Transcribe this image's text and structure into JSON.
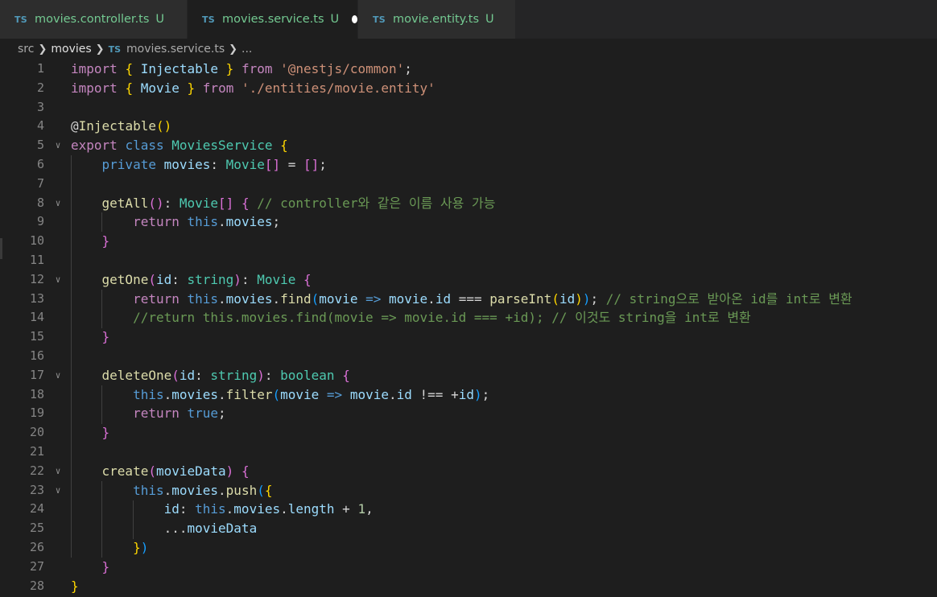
{
  "tabs": [
    {
      "icon": "TS",
      "name": "movies.controller.ts",
      "status": "U",
      "active": false,
      "dirty": false
    },
    {
      "icon": "TS",
      "name": "movies.service.ts",
      "status": "U",
      "active": true,
      "dirty": true
    },
    {
      "icon": "TS",
      "name": "movie.entity.ts",
      "status": "U",
      "active": false,
      "dirty": false
    }
  ],
  "breadcrumb": {
    "items": [
      "src",
      "movies"
    ],
    "file_icon": "TS",
    "file": "movies.service.ts",
    "more": "..."
  },
  "colors": {
    "keyword": "#c586c0",
    "storage": "#569cd6",
    "class": "#4ec9b0",
    "function": "#dcdcaa",
    "variable": "#9cdcfe",
    "string": "#ce9178",
    "comment": "#6a9955",
    "number": "#b5cea8",
    "bracket1": "#ffd700",
    "bracket2": "#da70d6",
    "bracket3": "#179fff",
    "text": "#d4d4d4"
  },
  "code": {
    "lines": [
      {
        "n": "1",
        "fold": false,
        "tokens": [
          [
            "import",
            "keyword"
          ],
          [
            " ",
            "text"
          ],
          [
            "{",
            "bracket1"
          ],
          [
            " Injectable ",
            "variable"
          ],
          [
            "}",
            "bracket1"
          ],
          [
            " ",
            "text"
          ],
          [
            "from",
            "keyword"
          ],
          [
            " ",
            "text"
          ],
          [
            "'@nestjs/common'",
            "string"
          ],
          [
            ";",
            "text"
          ]
        ]
      },
      {
        "n": "2",
        "fold": false,
        "tokens": [
          [
            "import",
            "keyword"
          ],
          [
            " ",
            "text"
          ],
          [
            "{",
            "bracket1"
          ],
          [
            " Movie ",
            "variable"
          ],
          [
            "}",
            "bracket1"
          ],
          [
            " ",
            "text"
          ],
          [
            "from",
            "keyword"
          ],
          [
            " ",
            "text"
          ],
          [
            "'./entities/movie.entity'",
            "string"
          ]
        ]
      },
      {
        "n": "3",
        "fold": false,
        "tokens": []
      },
      {
        "n": "4",
        "fold": false,
        "tokens": [
          [
            "@",
            "text"
          ],
          [
            "Injectable",
            "function"
          ],
          [
            "()",
            "bracket1"
          ]
        ]
      },
      {
        "n": "5",
        "fold": true,
        "tokens": [
          [
            "export",
            "keyword"
          ],
          [
            " ",
            "text"
          ],
          [
            "class",
            "storage"
          ],
          [
            " ",
            "text"
          ],
          [
            "MoviesService",
            "class"
          ],
          [
            " ",
            "text"
          ],
          [
            "{",
            "bracket1"
          ]
        ]
      },
      {
        "n": "6",
        "fold": false,
        "tokens": [
          [
            "    ",
            "text"
          ],
          [
            "private",
            "storage"
          ],
          [
            " ",
            "text"
          ],
          [
            "movies",
            "variable"
          ],
          [
            ": ",
            "text"
          ],
          [
            "Movie",
            "class"
          ],
          [
            "[]",
            "bracket2"
          ],
          [
            " = ",
            "text"
          ],
          [
            "[]",
            "bracket2"
          ],
          [
            ";",
            "text"
          ]
        ]
      },
      {
        "n": "7",
        "fold": false,
        "tokens": []
      },
      {
        "n": "8",
        "fold": true,
        "tokens": [
          [
            "    ",
            "text"
          ],
          [
            "getAll",
            "function"
          ],
          [
            "()",
            "bracket2"
          ],
          [
            ": ",
            "text"
          ],
          [
            "Movie",
            "class"
          ],
          [
            "[]",
            "bracket2"
          ],
          [
            " ",
            "text"
          ],
          [
            "{",
            "bracket2"
          ],
          [
            " ",
            "text"
          ],
          [
            "// controller와 같은 이름 사용 가능",
            "comment"
          ]
        ]
      },
      {
        "n": "9",
        "fold": false,
        "tokens": [
          [
            "        ",
            "text"
          ],
          [
            "return",
            "keyword"
          ],
          [
            " ",
            "text"
          ],
          [
            "this",
            "storage"
          ],
          [
            ".",
            "text"
          ],
          [
            "movies",
            "variable"
          ],
          [
            ";",
            "text"
          ]
        ]
      },
      {
        "n": "10",
        "fold": false,
        "tokens": [
          [
            "    ",
            "text"
          ],
          [
            "}",
            "bracket2"
          ]
        ]
      },
      {
        "n": "11",
        "fold": false,
        "tokens": []
      },
      {
        "n": "12",
        "fold": true,
        "tokens": [
          [
            "    ",
            "text"
          ],
          [
            "getOne",
            "function"
          ],
          [
            "(",
            "bracket2"
          ],
          [
            "id",
            "variable"
          ],
          [
            ": ",
            "text"
          ],
          [
            "string",
            "class"
          ],
          [
            ")",
            "bracket2"
          ],
          [
            ": ",
            "text"
          ],
          [
            "Movie",
            "class"
          ],
          [
            " ",
            "text"
          ],
          [
            "{",
            "bracket2"
          ]
        ]
      },
      {
        "n": "13",
        "fold": false,
        "tokens": [
          [
            "        ",
            "text"
          ],
          [
            "return",
            "keyword"
          ],
          [
            " ",
            "text"
          ],
          [
            "this",
            "storage"
          ],
          [
            ".",
            "text"
          ],
          [
            "movies",
            "variable"
          ],
          [
            ".",
            "text"
          ],
          [
            "find",
            "function"
          ],
          [
            "(",
            "bracket3"
          ],
          [
            "movie",
            "variable"
          ],
          [
            " ",
            "text"
          ],
          [
            "=>",
            "storage"
          ],
          [
            " ",
            "text"
          ],
          [
            "movie",
            "variable"
          ],
          [
            ".",
            "text"
          ],
          [
            "id",
            "variable"
          ],
          [
            " === ",
            "text"
          ],
          [
            "parseInt",
            "function"
          ],
          [
            "(",
            "bracket1"
          ],
          [
            "id",
            "variable"
          ],
          [
            ")",
            "bracket1"
          ],
          [
            ")",
            "bracket3"
          ],
          [
            ";",
            "text"
          ],
          [
            " ",
            "text"
          ],
          [
            "// string으로 받아온 id를 int로 변환",
            "comment"
          ]
        ]
      },
      {
        "n": "14",
        "fold": false,
        "tokens": [
          [
            "        ",
            "text"
          ],
          [
            "//return this.movies.find(movie => movie.id === +id); // 이것도 string을 int로 변환",
            "comment"
          ]
        ]
      },
      {
        "n": "15",
        "fold": false,
        "tokens": [
          [
            "    ",
            "text"
          ],
          [
            "}",
            "bracket2"
          ]
        ]
      },
      {
        "n": "16",
        "fold": false,
        "tokens": []
      },
      {
        "n": "17",
        "fold": true,
        "tokens": [
          [
            "    ",
            "text"
          ],
          [
            "deleteOne",
            "function"
          ],
          [
            "(",
            "bracket2"
          ],
          [
            "id",
            "variable"
          ],
          [
            ": ",
            "text"
          ],
          [
            "string",
            "class"
          ],
          [
            ")",
            "bracket2"
          ],
          [
            ": ",
            "text"
          ],
          [
            "boolean",
            "class"
          ],
          [
            " ",
            "text"
          ],
          [
            "{",
            "bracket2"
          ]
        ]
      },
      {
        "n": "18",
        "fold": false,
        "tokens": [
          [
            "        ",
            "text"
          ],
          [
            "this",
            "storage"
          ],
          [
            ".",
            "text"
          ],
          [
            "movies",
            "variable"
          ],
          [
            ".",
            "text"
          ],
          [
            "filter",
            "function"
          ],
          [
            "(",
            "bracket3"
          ],
          [
            "movie",
            "variable"
          ],
          [
            " ",
            "text"
          ],
          [
            "=>",
            "storage"
          ],
          [
            " ",
            "text"
          ],
          [
            "movie",
            "variable"
          ],
          [
            ".",
            "text"
          ],
          [
            "id",
            "variable"
          ],
          [
            " !== +",
            "text"
          ],
          [
            "id",
            "variable"
          ],
          [
            ")",
            "bracket3"
          ],
          [
            ";",
            "text"
          ]
        ]
      },
      {
        "n": "19",
        "fold": false,
        "tokens": [
          [
            "        ",
            "text"
          ],
          [
            "return",
            "keyword"
          ],
          [
            " ",
            "text"
          ],
          [
            "true",
            "storage"
          ],
          [
            ";",
            "text"
          ]
        ]
      },
      {
        "n": "20",
        "fold": false,
        "tokens": [
          [
            "    ",
            "text"
          ],
          [
            "}",
            "bracket2"
          ]
        ]
      },
      {
        "n": "21",
        "fold": false,
        "tokens": []
      },
      {
        "n": "22",
        "fold": true,
        "tokens": [
          [
            "    ",
            "text"
          ],
          [
            "create",
            "function"
          ],
          [
            "(",
            "bracket2"
          ],
          [
            "movieData",
            "variable"
          ],
          [
            ")",
            "bracket2"
          ],
          [
            " ",
            "text"
          ],
          [
            "{",
            "bracket2"
          ]
        ]
      },
      {
        "n": "23",
        "fold": true,
        "tokens": [
          [
            "        ",
            "text"
          ],
          [
            "this",
            "storage"
          ],
          [
            ".",
            "text"
          ],
          [
            "movies",
            "variable"
          ],
          [
            ".",
            "text"
          ],
          [
            "push",
            "function"
          ],
          [
            "(",
            "bracket3"
          ],
          [
            "{",
            "bracket1"
          ]
        ]
      },
      {
        "n": "24",
        "fold": false,
        "tokens": [
          [
            "            ",
            "text"
          ],
          [
            "id",
            "variable"
          ],
          [
            ": ",
            "text"
          ],
          [
            "this",
            "storage"
          ],
          [
            ".",
            "text"
          ],
          [
            "movies",
            "variable"
          ],
          [
            ".",
            "text"
          ],
          [
            "length",
            "variable"
          ],
          [
            " + ",
            "text"
          ],
          [
            "1",
            "number"
          ],
          [
            ",",
            "text"
          ]
        ]
      },
      {
        "n": "25",
        "fold": false,
        "tokens": [
          [
            "            ...",
            "text"
          ],
          [
            "movieData",
            "variable"
          ]
        ]
      },
      {
        "n": "26",
        "fold": false,
        "tokens": [
          [
            "        ",
            "text"
          ],
          [
            "}",
            "bracket1"
          ],
          [
            ")",
            "bracket3"
          ]
        ]
      },
      {
        "n": "27",
        "fold": false,
        "tokens": [
          [
            "    ",
            "text"
          ],
          [
            "}",
            "bracket2"
          ]
        ]
      },
      {
        "n": "28",
        "fold": false,
        "tokens": [
          [
            "}",
            "bracket1"
          ]
        ]
      }
    ]
  }
}
